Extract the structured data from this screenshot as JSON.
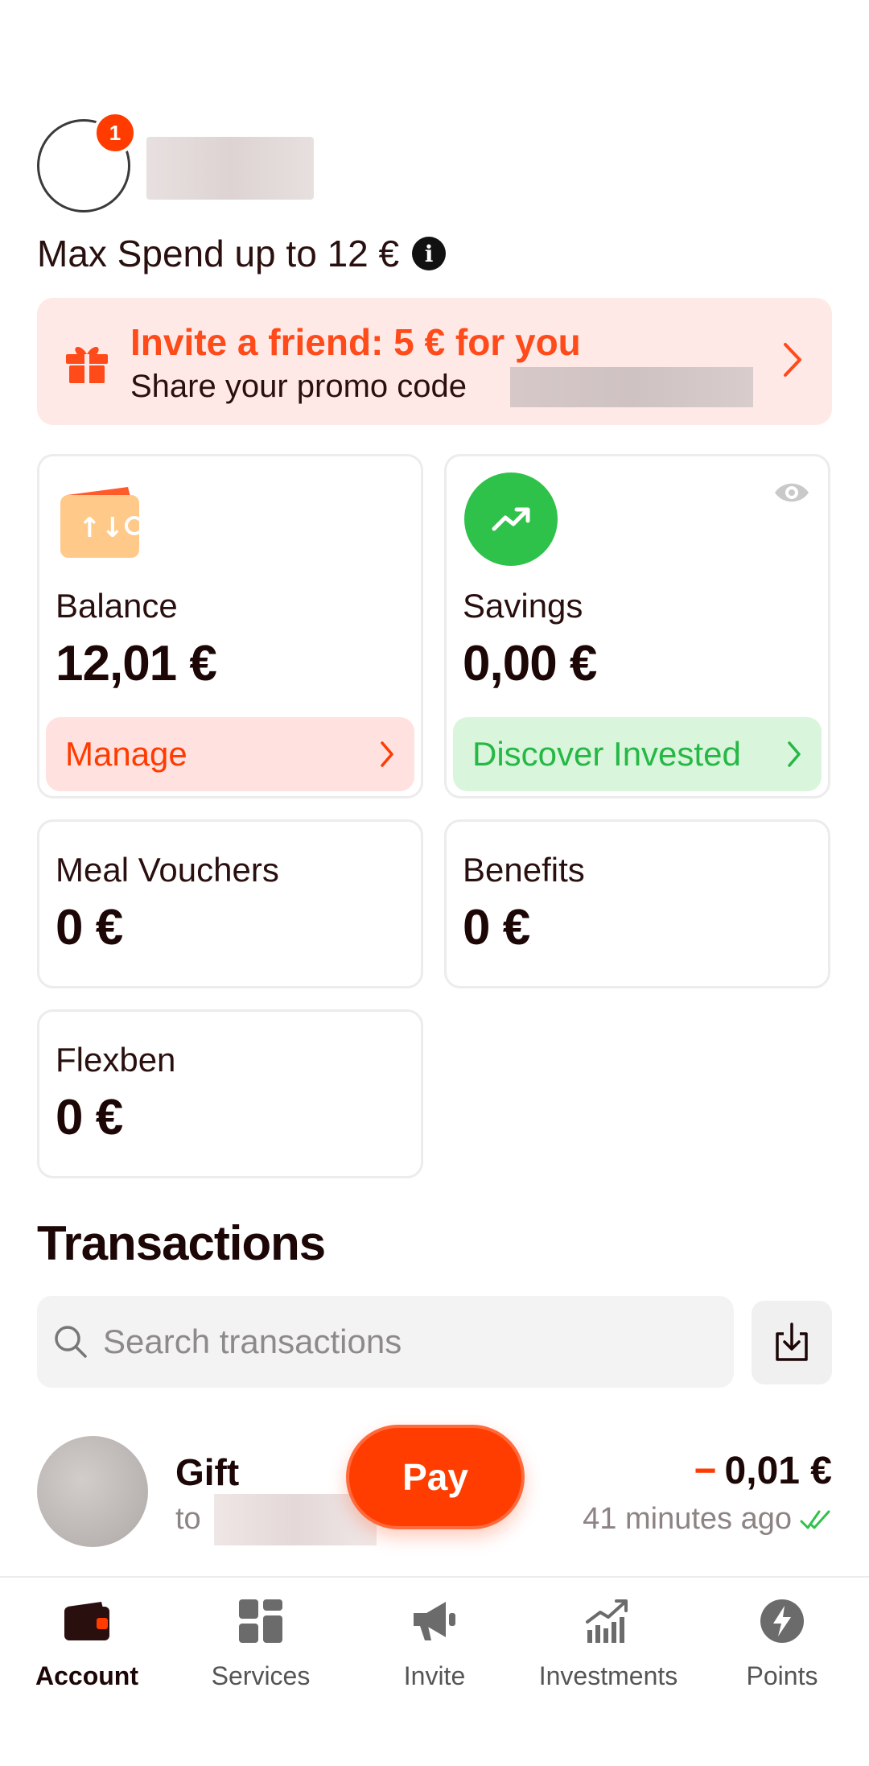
{
  "header": {
    "notification_count": "1",
    "max_spend": "Max Spend up to 12 €"
  },
  "invite": {
    "title": "Invite a friend: 5 € for you",
    "subtitle": "Share your promo code"
  },
  "cards": {
    "balance": {
      "label": "Balance",
      "value": "12,01 €",
      "action": "Manage"
    },
    "savings": {
      "label": "Savings",
      "value": "0,00 €",
      "action": "Discover Invested"
    },
    "meal": {
      "label": "Meal Vouchers",
      "value": "0 €"
    },
    "benefits": {
      "label": "Benefits",
      "value": "0 €"
    },
    "flexben": {
      "label": "Flexben",
      "value": "0 €"
    }
  },
  "transactions": {
    "title": "Transactions",
    "search_placeholder": "Search transactions",
    "items": [
      {
        "name": "Gift",
        "to_prefix": "to",
        "amount": "0,01 €",
        "sign": "−",
        "time": "41 minutes ago"
      }
    ]
  },
  "pay_button": "Pay",
  "nav": [
    {
      "label": "Account",
      "icon": "wallet-icon",
      "active": true
    },
    {
      "label": "Services",
      "icon": "grid-icon",
      "active": false
    },
    {
      "label": "Invite",
      "icon": "megaphone-icon",
      "active": false
    },
    {
      "label": "Investments",
      "icon": "chart-icon",
      "active": false
    },
    {
      "label": "Points",
      "icon": "lightning-icon",
      "active": false
    }
  ],
  "colors": {
    "accent": "#ff3b00",
    "invite_bg": "#ffe9e7",
    "manage_bg": "#ffe1df",
    "invest_bg": "#d9f5dc",
    "invest_text": "#26b845",
    "savings_icon": "#2fc24a",
    "wallet_icon": "#ffc98a"
  }
}
